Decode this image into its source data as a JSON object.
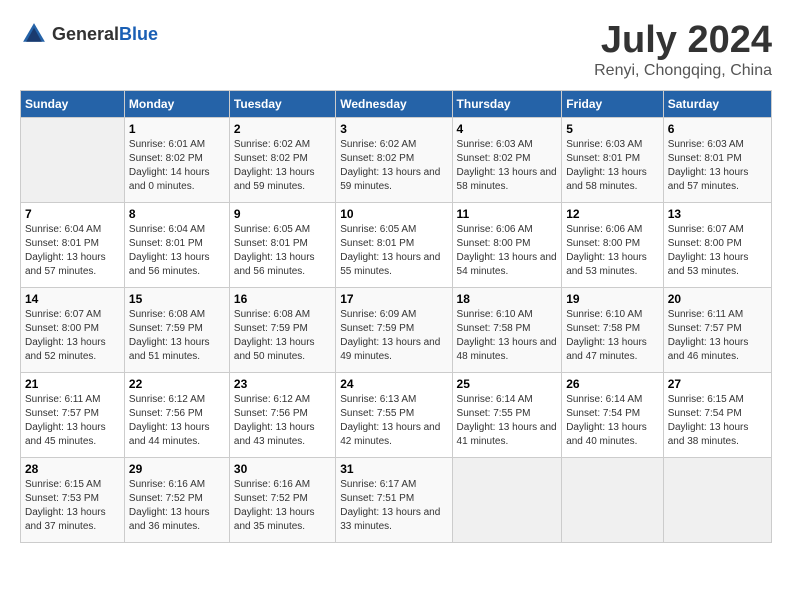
{
  "header": {
    "logo_general": "General",
    "logo_blue": "Blue",
    "month": "July 2024",
    "location": "Renyi, Chongqing, China"
  },
  "weekdays": [
    "Sunday",
    "Monday",
    "Tuesday",
    "Wednesday",
    "Thursday",
    "Friday",
    "Saturday"
  ],
  "weeks": [
    [
      {
        "day": "",
        "sunrise": "",
        "sunset": "",
        "daylight": ""
      },
      {
        "day": "1",
        "sunrise": "Sunrise: 6:01 AM",
        "sunset": "Sunset: 8:02 PM",
        "daylight": "Daylight: 14 hours and 0 minutes."
      },
      {
        "day": "2",
        "sunrise": "Sunrise: 6:02 AM",
        "sunset": "Sunset: 8:02 PM",
        "daylight": "Daylight: 13 hours and 59 minutes."
      },
      {
        "day": "3",
        "sunrise": "Sunrise: 6:02 AM",
        "sunset": "Sunset: 8:02 PM",
        "daylight": "Daylight: 13 hours and 59 minutes."
      },
      {
        "day": "4",
        "sunrise": "Sunrise: 6:03 AM",
        "sunset": "Sunset: 8:02 PM",
        "daylight": "Daylight: 13 hours and 58 minutes."
      },
      {
        "day": "5",
        "sunrise": "Sunrise: 6:03 AM",
        "sunset": "Sunset: 8:01 PM",
        "daylight": "Daylight: 13 hours and 58 minutes."
      },
      {
        "day": "6",
        "sunrise": "Sunrise: 6:03 AM",
        "sunset": "Sunset: 8:01 PM",
        "daylight": "Daylight: 13 hours and 57 minutes."
      }
    ],
    [
      {
        "day": "7",
        "sunrise": "Sunrise: 6:04 AM",
        "sunset": "Sunset: 8:01 PM",
        "daylight": "Daylight: 13 hours and 57 minutes."
      },
      {
        "day": "8",
        "sunrise": "Sunrise: 6:04 AM",
        "sunset": "Sunset: 8:01 PM",
        "daylight": "Daylight: 13 hours and 56 minutes."
      },
      {
        "day": "9",
        "sunrise": "Sunrise: 6:05 AM",
        "sunset": "Sunset: 8:01 PM",
        "daylight": "Daylight: 13 hours and 56 minutes."
      },
      {
        "day": "10",
        "sunrise": "Sunrise: 6:05 AM",
        "sunset": "Sunset: 8:01 PM",
        "daylight": "Daylight: 13 hours and 55 minutes."
      },
      {
        "day": "11",
        "sunrise": "Sunrise: 6:06 AM",
        "sunset": "Sunset: 8:00 PM",
        "daylight": "Daylight: 13 hours and 54 minutes."
      },
      {
        "day": "12",
        "sunrise": "Sunrise: 6:06 AM",
        "sunset": "Sunset: 8:00 PM",
        "daylight": "Daylight: 13 hours and 53 minutes."
      },
      {
        "day": "13",
        "sunrise": "Sunrise: 6:07 AM",
        "sunset": "Sunset: 8:00 PM",
        "daylight": "Daylight: 13 hours and 53 minutes."
      }
    ],
    [
      {
        "day": "14",
        "sunrise": "Sunrise: 6:07 AM",
        "sunset": "Sunset: 8:00 PM",
        "daylight": "Daylight: 13 hours and 52 minutes."
      },
      {
        "day": "15",
        "sunrise": "Sunrise: 6:08 AM",
        "sunset": "Sunset: 7:59 PM",
        "daylight": "Daylight: 13 hours and 51 minutes."
      },
      {
        "day": "16",
        "sunrise": "Sunrise: 6:08 AM",
        "sunset": "Sunset: 7:59 PM",
        "daylight": "Daylight: 13 hours and 50 minutes."
      },
      {
        "day": "17",
        "sunrise": "Sunrise: 6:09 AM",
        "sunset": "Sunset: 7:59 PM",
        "daylight": "Daylight: 13 hours and 49 minutes."
      },
      {
        "day": "18",
        "sunrise": "Sunrise: 6:10 AM",
        "sunset": "Sunset: 7:58 PM",
        "daylight": "Daylight: 13 hours and 48 minutes."
      },
      {
        "day": "19",
        "sunrise": "Sunrise: 6:10 AM",
        "sunset": "Sunset: 7:58 PM",
        "daylight": "Daylight: 13 hours and 47 minutes."
      },
      {
        "day": "20",
        "sunrise": "Sunrise: 6:11 AM",
        "sunset": "Sunset: 7:57 PM",
        "daylight": "Daylight: 13 hours and 46 minutes."
      }
    ],
    [
      {
        "day": "21",
        "sunrise": "Sunrise: 6:11 AM",
        "sunset": "Sunset: 7:57 PM",
        "daylight": "Daylight: 13 hours and 45 minutes."
      },
      {
        "day": "22",
        "sunrise": "Sunrise: 6:12 AM",
        "sunset": "Sunset: 7:56 PM",
        "daylight": "Daylight: 13 hours and 44 minutes."
      },
      {
        "day": "23",
        "sunrise": "Sunrise: 6:12 AM",
        "sunset": "Sunset: 7:56 PM",
        "daylight": "Daylight: 13 hours and 43 minutes."
      },
      {
        "day": "24",
        "sunrise": "Sunrise: 6:13 AM",
        "sunset": "Sunset: 7:55 PM",
        "daylight": "Daylight: 13 hours and 42 minutes."
      },
      {
        "day": "25",
        "sunrise": "Sunrise: 6:14 AM",
        "sunset": "Sunset: 7:55 PM",
        "daylight": "Daylight: 13 hours and 41 minutes."
      },
      {
        "day": "26",
        "sunrise": "Sunrise: 6:14 AM",
        "sunset": "Sunset: 7:54 PM",
        "daylight": "Daylight: 13 hours and 40 minutes."
      },
      {
        "day": "27",
        "sunrise": "Sunrise: 6:15 AM",
        "sunset": "Sunset: 7:54 PM",
        "daylight": "Daylight: 13 hours and 38 minutes."
      }
    ],
    [
      {
        "day": "28",
        "sunrise": "Sunrise: 6:15 AM",
        "sunset": "Sunset: 7:53 PM",
        "daylight": "Daylight: 13 hours and 37 minutes."
      },
      {
        "day": "29",
        "sunrise": "Sunrise: 6:16 AM",
        "sunset": "Sunset: 7:52 PM",
        "daylight": "Daylight: 13 hours and 36 minutes."
      },
      {
        "day": "30",
        "sunrise": "Sunrise: 6:16 AM",
        "sunset": "Sunset: 7:52 PM",
        "daylight": "Daylight: 13 hours and 35 minutes."
      },
      {
        "day": "31",
        "sunrise": "Sunrise: 6:17 AM",
        "sunset": "Sunset: 7:51 PM",
        "daylight": "Daylight: 13 hours and 33 minutes."
      },
      {
        "day": "",
        "sunrise": "",
        "sunset": "",
        "daylight": ""
      },
      {
        "day": "",
        "sunrise": "",
        "sunset": "",
        "daylight": ""
      },
      {
        "day": "",
        "sunrise": "",
        "sunset": "",
        "daylight": ""
      }
    ]
  ]
}
